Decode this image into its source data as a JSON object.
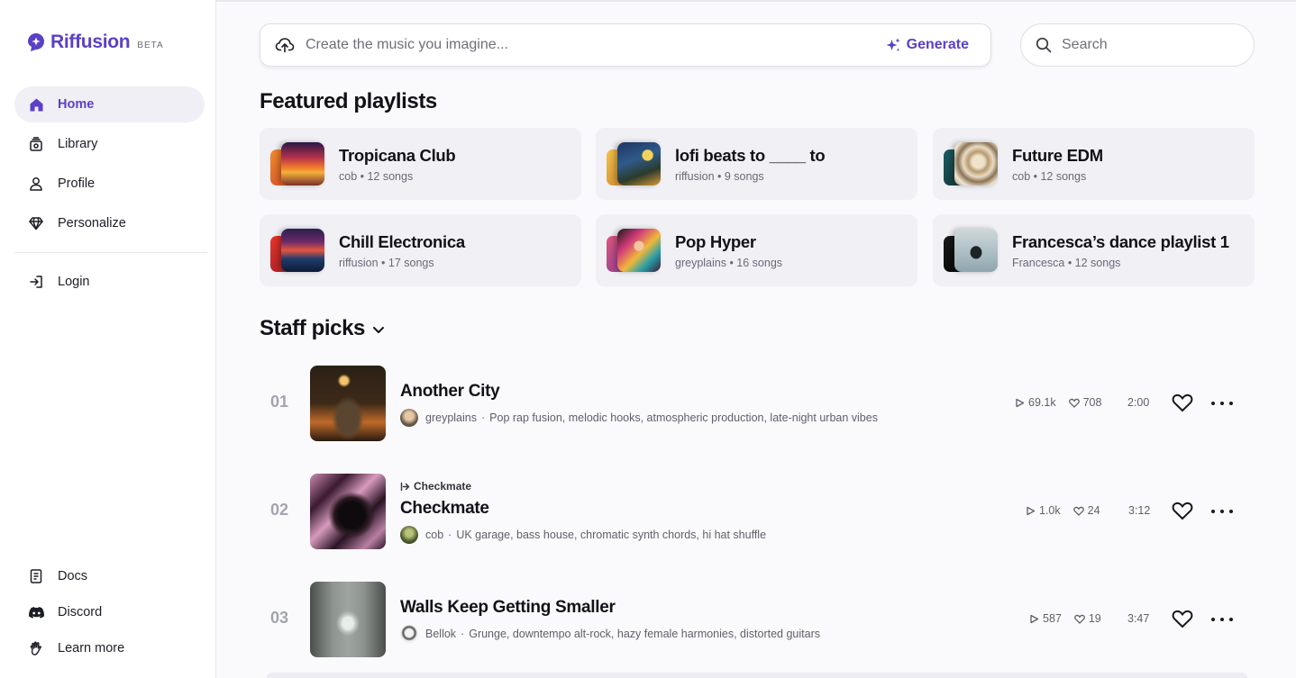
{
  "brand": {
    "name": "Riffusion",
    "badge": "BETA",
    "accent": "#5b3fc7"
  },
  "nav": {
    "items": [
      {
        "label": "Home",
        "icon": "home-icon",
        "active": true
      },
      {
        "label": "Library",
        "icon": "library-icon"
      },
      {
        "label": "Profile",
        "icon": "person-icon"
      },
      {
        "label": "Personalize",
        "icon": "diamond-icon"
      }
    ],
    "login": {
      "label": "Login",
      "icon": "login-icon"
    },
    "bottom": [
      {
        "label": "Docs",
        "icon": "document-icon"
      },
      {
        "label": "Discord",
        "icon": "discord-icon"
      },
      {
        "label": "Learn more",
        "icon": "hand-wave-icon"
      }
    ]
  },
  "prompt": {
    "placeholder": "Create the music you imagine...",
    "generate_label": "Generate"
  },
  "search": {
    "placeholder": "Search"
  },
  "featured": {
    "title": "Featured playlists",
    "playlists": [
      {
        "name": "Tropicana Club",
        "meta": "cob • 12 songs"
      },
      {
        "name": "lofi beats to ____ to",
        "meta": "riffusion • 9 songs"
      },
      {
        "name": "Future EDM",
        "meta": "cob • 12 songs"
      },
      {
        "name": "Chill Electronica",
        "meta": "riffusion • 17 songs"
      },
      {
        "name": "Pop Hyper",
        "meta": "greyplains • 16 songs"
      },
      {
        "name": "Francesca’s dance playlist 1",
        "meta": "Francesca • 12 songs"
      }
    ]
  },
  "staff": {
    "title": "Staff picks",
    "tracks": [
      {
        "number": "01",
        "title": "Another City",
        "parent": "",
        "artist": "greyplains",
        "tags": "Pop rap fusion, melodic hooks, atmospheric production, late-night urban vibes",
        "plays": "69.1k",
        "likes": "708",
        "duration": "2:00"
      },
      {
        "number": "02",
        "title": "Checkmate",
        "parent": "Checkmate",
        "artist": "cob",
        "tags": "UK garage, bass house, chromatic synth chords, hi hat shuffle",
        "plays": "1.0k",
        "likes": "24",
        "duration": "3:12"
      },
      {
        "number": "03",
        "title": "Walls Keep Getting Smaller",
        "parent": "",
        "artist": "Bellok",
        "tags": "Grunge, downtempo alt-rock, hazy female harmonies, distorted guitars",
        "plays": "587",
        "likes": "19",
        "duration": "3:47"
      }
    ]
  }
}
